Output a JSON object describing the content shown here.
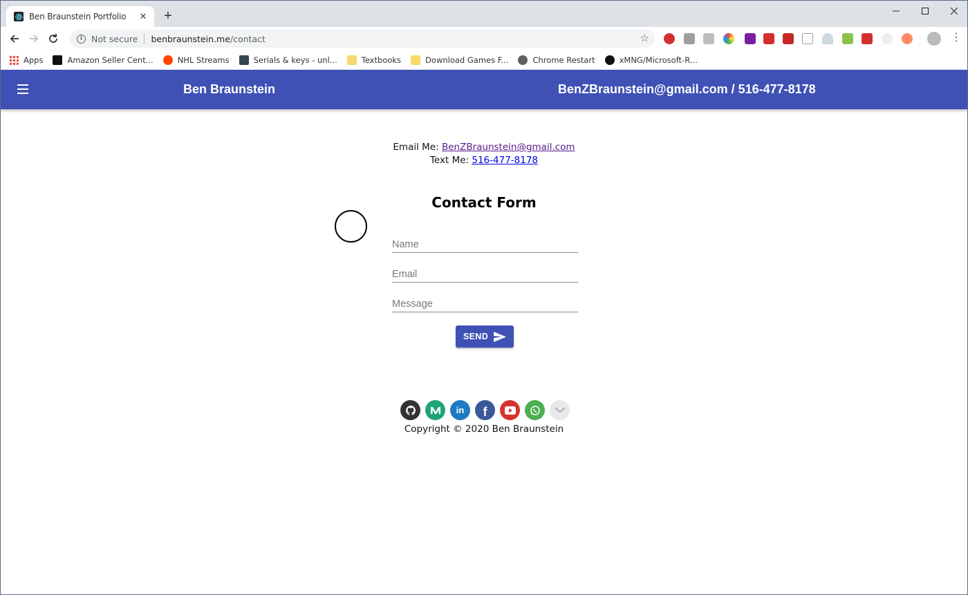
{
  "browser": {
    "tab_title": "Ben Braunstein Portfolio",
    "security_label": "Not secure",
    "url_host": "benbraunstein.me",
    "url_path": "/contact",
    "bookmarks": [
      {
        "label": "Apps",
        "icon": "apps-grid-icon"
      },
      {
        "label": "Amazon Seller Cent...",
        "icon": "amazon-icon"
      },
      {
        "label": "NHL Streams",
        "icon": "reddit-icon"
      },
      {
        "label": "Serials & keys - unl...",
        "icon": "site-icon"
      },
      {
        "label": "Textbooks",
        "icon": "folder-icon"
      },
      {
        "label": "Download Games F...",
        "icon": "folder-icon"
      },
      {
        "label": "Chrome Restart",
        "icon": "globe-icon"
      },
      {
        "label": "xMNG/Microsoft-R...",
        "icon": "github-icon"
      }
    ]
  },
  "appbar": {
    "brand": "Ben Braunstein",
    "contact": "BenZBraunstein@gmail.com / 516-477-8178",
    "color": "#3f51b5"
  },
  "contact": {
    "email_label": "Email Me:",
    "email": "BenZBraunstein@gmail.com",
    "text_label": "Text Me:",
    "phone": "516-477-8178"
  },
  "form": {
    "title": "Contact Form",
    "name_placeholder": "Name",
    "email_placeholder": "Email",
    "message_placeholder": "Message",
    "send_label": "SEND"
  },
  "footer": {
    "socials": [
      {
        "icon": "github-icon",
        "color": "#333333"
      },
      {
        "icon": "medium-icon",
        "color": "#1fa37a"
      },
      {
        "icon": "linkedin-icon",
        "color": "#1f7bc1"
      },
      {
        "icon": "facebook-icon",
        "color": "#3b5998"
      },
      {
        "icon": "youtube-icon",
        "color": "#d6322e"
      },
      {
        "icon": "whatsapp-icon",
        "color": "#4caf50"
      },
      {
        "icon": "email-icon",
        "color": "#e6e6e6"
      }
    ],
    "copyright": "Copyright © 2020 Ben Braunstein"
  }
}
